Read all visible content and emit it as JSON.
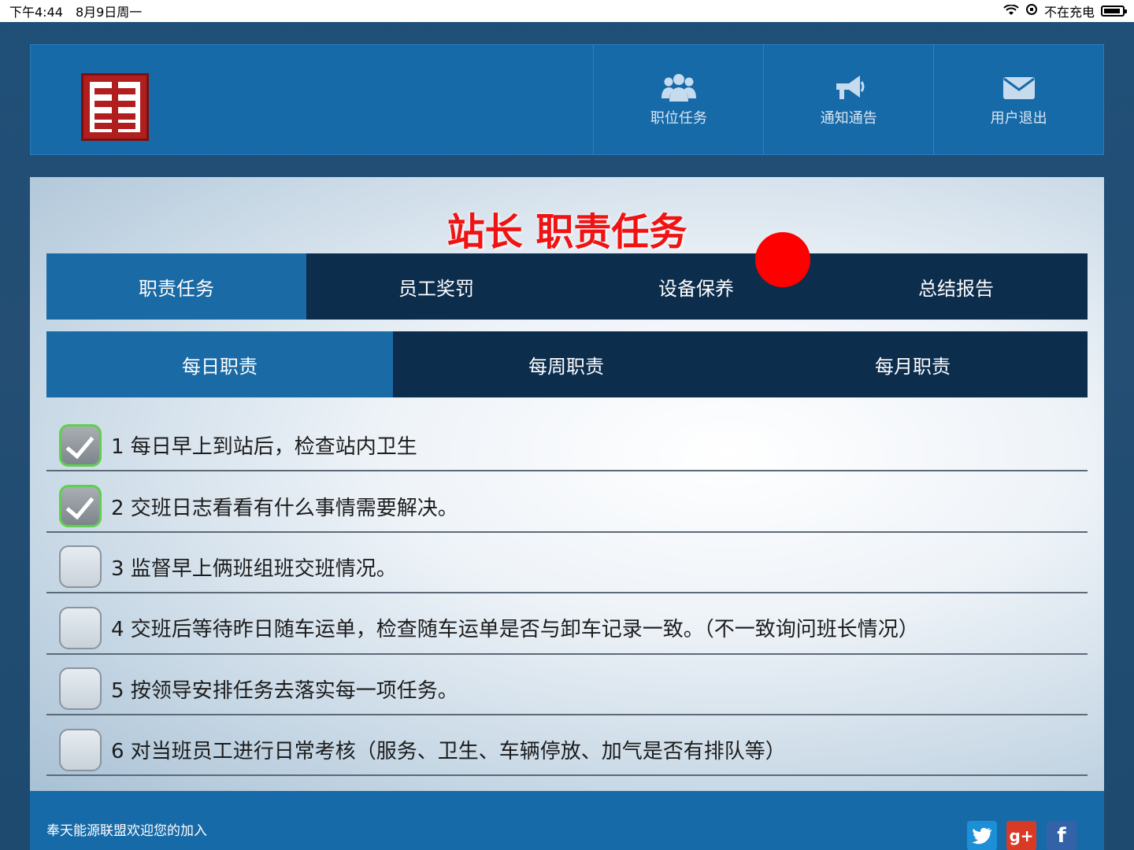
{
  "status_bar": {
    "time": "下午4:44",
    "date": "8月9日周一",
    "charging": "不在充电"
  },
  "header": {
    "nav": [
      {
        "label": "职位任务",
        "icon": "users-icon"
      },
      {
        "label": "通知通告",
        "icon": "megaphone-icon"
      },
      {
        "label": "用户退出",
        "icon": "envelope-icon"
      }
    ]
  },
  "page": {
    "title": "站长 职责任务"
  },
  "tabs_primary": [
    {
      "label": "职责任务",
      "active": true
    },
    {
      "label": "员工奖罚",
      "active": false
    },
    {
      "label": "设备保养",
      "active": false
    },
    {
      "label": "总结报告",
      "active": false
    }
  ],
  "tabs_secondary": [
    {
      "label": "每日职责",
      "active": true
    },
    {
      "label": "每周职责",
      "active": false
    },
    {
      "label": "每月职责",
      "active": false
    }
  ],
  "tasks": [
    {
      "text": "1 每日早上到站后，检查站内卫生",
      "checked": true
    },
    {
      "text": "2 交班日志看看有什么事情需要解决。",
      "checked": true
    },
    {
      "text": "3 监督早上俩班组班交班情况。",
      "checked": false
    },
    {
      "text": "4 交班后等待昨日随车运单，检查随车运单是否与卸车记录一致。（不一致询问班长情况）",
      "checked": false
    },
    {
      "text": "5 按领导安排任务去落实每一项任务。",
      "checked": false
    },
    {
      "text": "6 对当班员工进行日常考核（服务、卫生、车辆停放、加气是否有排队等）",
      "checked": false
    }
  ],
  "footer": {
    "text": "奉天能源联盟欢迎您的加入",
    "social": [
      {
        "name": "twitter-icon",
        "glyph": "🐦"
      },
      {
        "name": "google-plus-icon",
        "glyph": "g+"
      },
      {
        "name": "facebook-icon",
        "glyph": "f"
      }
    ]
  },
  "colors": {
    "accent": "#176aa8",
    "tab_dark": "#0d2d4d",
    "title_red": "#f01313",
    "check_green": "#5fcf4e",
    "indicator_red": "#ff0000"
  }
}
